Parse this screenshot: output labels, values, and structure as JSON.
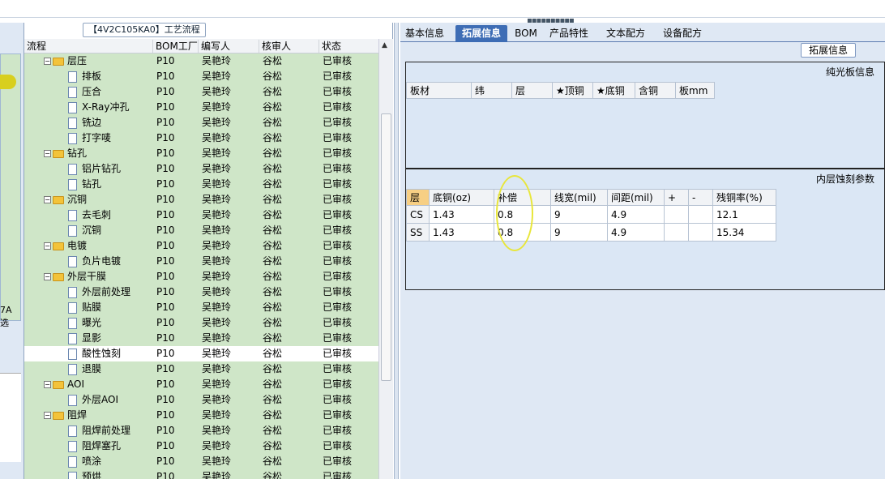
{
  "left_strip": {
    "label1": "7A",
    "label2": "选"
  },
  "tree": {
    "title": "【4V2C105KA0】工艺流程",
    "headers": {
      "process": "流程",
      "bom": "BOM工厂",
      "writer": "编写人",
      "reviewer": "核审人",
      "status": "状态"
    },
    "rows": [
      {
        "name": "层压",
        "type": "folder",
        "bom": "P10",
        "writer": "吴艳玲",
        "reviewer": "谷松",
        "status": "已审核"
      },
      {
        "name": "排板",
        "type": "doc",
        "bom": "P10",
        "writer": "吴艳玲",
        "reviewer": "谷松",
        "status": "已审核"
      },
      {
        "name": "压合",
        "type": "doc",
        "bom": "P10",
        "writer": "吴艳玲",
        "reviewer": "谷松",
        "status": "已审核"
      },
      {
        "name": "X-Ray冲孔",
        "type": "doc",
        "bom": "P10",
        "writer": "吴艳玲",
        "reviewer": "谷松",
        "status": "已审核"
      },
      {
        "name": "铣边",
        "type": "doc",
        "bom": "P10",
        "writer": "吴艳玲",
        "reviewer": "谷松",
        "status": "已审核"
      },
      {
        "name": "打字唛",
        "type": "doc",
        "bom": "P10",
        "writer": "吴艳玲",
        "reviewer": "谷松",
        "status": "已审核"
      },
      {
        "name": "钻孔",
        "type": "folder",
        "bom": "P10",
        "writer": "吴艳玲",
        "reviewer": "谷松",
        "status": "已审核"
      },
      {
        "name": "铝片钻孔",
        "type": "doc",
        "bom": "P10",
        "writer": "吴艳玲",
        "reviewer": "谷松",
        "status": "已审核"
      },
      {
        "name": "钻孔",
        "type": "doc",
        "bom": "P10",
        "writer": "吴艳玲",
        "reviewer": "谷松",
        "status": "已审核"
      },
      {
        "name": "沉铜",
        "type": "folder",
        "bom": "P10",
        "writer": "吴艳玲",
        "reviewer": "谷松",
        "status": "已审核"
      },
      {
        "name": "去毛刺",
        "type": "doc",
        "bom": "P10",
        "writer": "吴艳玲",
        "reviewer": "谷松",
        "status": "已审核"
      },
      {
        "name": "沉铜",
        "type": "doc",
        "bom": "P10",
        "writer": "吴艳玲",
        "reviewer": "谷松",
        "status": "已审核"
      },
      {
        "name": "电镀",
        "type": "folder",
        "bom": "P10",
        "writer": "吴艳玲",
        "reviewer": "谷松",
        "status": "已审核"
      },
      {
        "name": "负片电镀",
        "type": "doc",
        "bom": "P10",
        "writer": "吴艳玲",
        "reviewer": "谷松",
        "status": "已审核"
      },
      {
        "name": "外层干膜",
        "type": "folder",
        "bom": "P10",
        "writer": "吴艳玲",
        "reviewer": "谷松",
        "status": "已审核"
      },
      {
        "name": "外层前处理",
        "type": "doc",
        "bom": "P10",
        "writer": "吴艳玲",
        "reviewer": "谷松",
        "status": "已审核"
      },
      {
        "name": "贴膜",
        "type": "doc",
        "bom": "P10",
        "writer": "吴艳玲",
        "reviewer": "谷松",
        "status": "已审核"
      },
      {
        "name": "曝光",
        "type": "doc",
        "bom": "P10",
        "writer": "吴艳玲",
        "reviewer": "谷松",
        "status": "已审核"
      },
      {
        "name": "显影",
        "type": "doc",
        "bom": "P10",
        "writer": "吴艳玲",
        "reviewer": "谷松",
        "status": "已审核"
      },
      {
        "name": "酸性蚀刻",
        "type": "doc",
        "bom": "P10",
        "writer": "吴艳玲",
        "reviewer": "谷松",
        "status": "已审核",
        "selected": true
      },
      {
        "name": "退膜",
        "type": "doc",
        "bom": "P10",
        "writer": "吴艳玲",
        "reviewer": "谷松",
        "status": "已审核"
      },
      {
        "name": "AOI",
        "type": "folder",
        "bom": "P10",
        "writer": "吴艳玲",
        "reviewer": "谷松",
        "status": "已审核"
      },
      {
        "name": "外层AOI",
        "type": "doc",
        "bom": "P10",
        "writer": "吴艳玲",
        "reviewer": "谷松",
        "status": "已审核"
      },
      {
        "name": "阻焊",
        "type": "folder",
        "bom": "P10",
        "writer": "吴艳玲",
        "reviewer": "谷松",
        "status": "已审核"
      },
      {
        "name": "阻焊前处理",
        "type": "doc",
        "bom": "P10",
        "writer": "吴艳玲",
        "reviewer": "谷松",
        "status": "已审核"
      },
      {
        "name": "阻焊塞孔",
        "type": "doc",
        "bom": "P10",
        "writer": "吴艳玲",
        "reviewer": "谷松",
        "status": "已审核"
      },
      {
        "name": "喷涂",
        "type": "doc",
        "bom": "P10",
        "writer": "吴艳玲",
        "reviewer": "谷松",
        "status": "已审核"
      },
      {
        "name": "预烘",
        "type": "doc",
        "bom": "P10",
        "writer": "吴艳玲",
        "reviewer": "谷松",
        "status": "已审核"
      }
    ]
  },
  "tabs": [
    "基本信息",
    "拓展信息",
    "BOM",
    "产品特性",
    "文本配方",
    "设备配方"
  ],
  "active_tab": "拓展信息",
  "ext_button": "拓展信息",
  "sec1": {
    "title": "纯光板信息",
    "headers": [
      "板材",
      "纬",
      "层",
      "★顶铜",
      "★底铜",
      "含铜",
      "板mm"
    ]
  },
  "sec2": {
    "title": "内层蚀刻参数",
    "headers": [
      "层",
      "底铜(oz)",
      "补偿",
      "线宽(mil)",
      "间距(mil)",
      "+",
      "-",
      "残铜率(%)"
    ],
    "rows": [
      [
        "CS",
        "1.43",
        "0.8",
        "9",
        "4.9",
        "",
        "",
        "12.1"
      ],
      [
        "SS",
        "1.43",
        "0.8",
        "9",
        "4.9",
        "",
        "",
        "15.34"
      ]
    ]
  },
  "colors": {
    "tree_bg": "#cfe6c8",
    "tab_active": "#3e6db5",
    "panel_bg": "#dbe7f5",
    "highlight": "#f7cf84",
    "annotation": "#e8e63a"
  }
}
